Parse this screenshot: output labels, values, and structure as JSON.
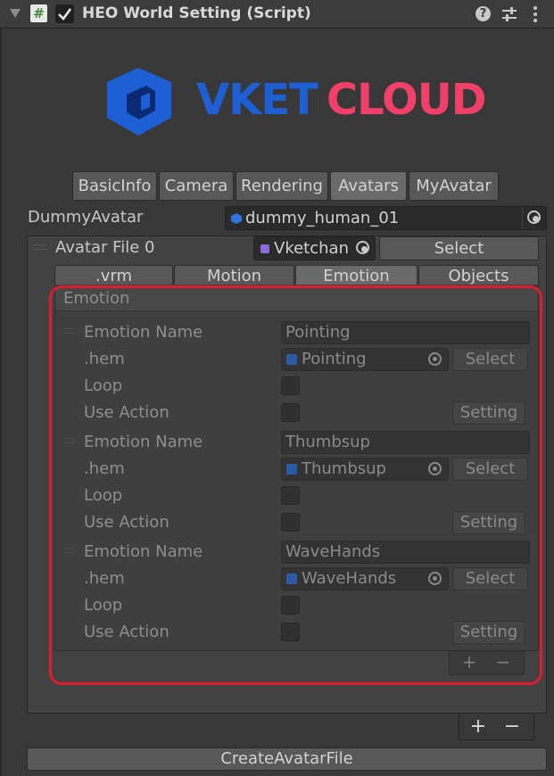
{
  "header": {
    "title": "HEO World Setting (Script)"
  },
  "logo": {
    "text_part1": "VKET",
    "text_part2": "CLOUD",
    "color1": "#1f5fd6",
    "color2": "#f0406a"
  },
  "tabs": [
    "BasicInfo",
    "Camera",
    "Rendering",
    "Avatars",
    "MyAvatar"
  ],
  "active_tab": "Avatars",
  "dummy_avatar": {
    "label": "DummyAvatar",
    "value": "dummy_human_01"
  },
  "avatar_file": {
    "label": "Avatar File 0",
    "value": "Vketchan",
    "select_label": "Select"
  },
  "subtabs": [
    ".vrm",
    "Motion",
    "Emotion",
    "Objects"
  ],
  "active_subtab": "Emotion",
  "emotion_section": {
    "title": "Emotion"
  },
  "emotions": [
    {
      "name_label": "Emotion Name",
      "name": "Pointing",
      "hem_label": ".hem",
      "hem": "Pointing",
      "select_label": "Select",
      "loop_label": "Loop",
      "action_label": "Use Action",
      "setting_label": "Setting"
    },
    {
      "name_label": "Emotion Name",
      "name": "Thumbsup",
      "hem_label": ".hem",
      "hem": "Thumbsup",
      "select_label": "Select",
      "loop_label": "Loop",
      "action_label": "Use Action",
      "setting_label": "Setting"
    },
    {
      "name_label": "Emotion Name",
      "name": "WaveHands",
      "hem_label": ".hem",
      "hem": "WaveHands",
      "select_label": "Select",
      "loop_label": "Loop",
      "action_label": "Use Action",
      "setting_label": "Setting"
    }
  ],
  "list_controls": {
    "add": "+",
    "remove": "−"
  },
  "create_button": "CreateAvatarFile",
  "highlight_color": "#e01c2a"
}
